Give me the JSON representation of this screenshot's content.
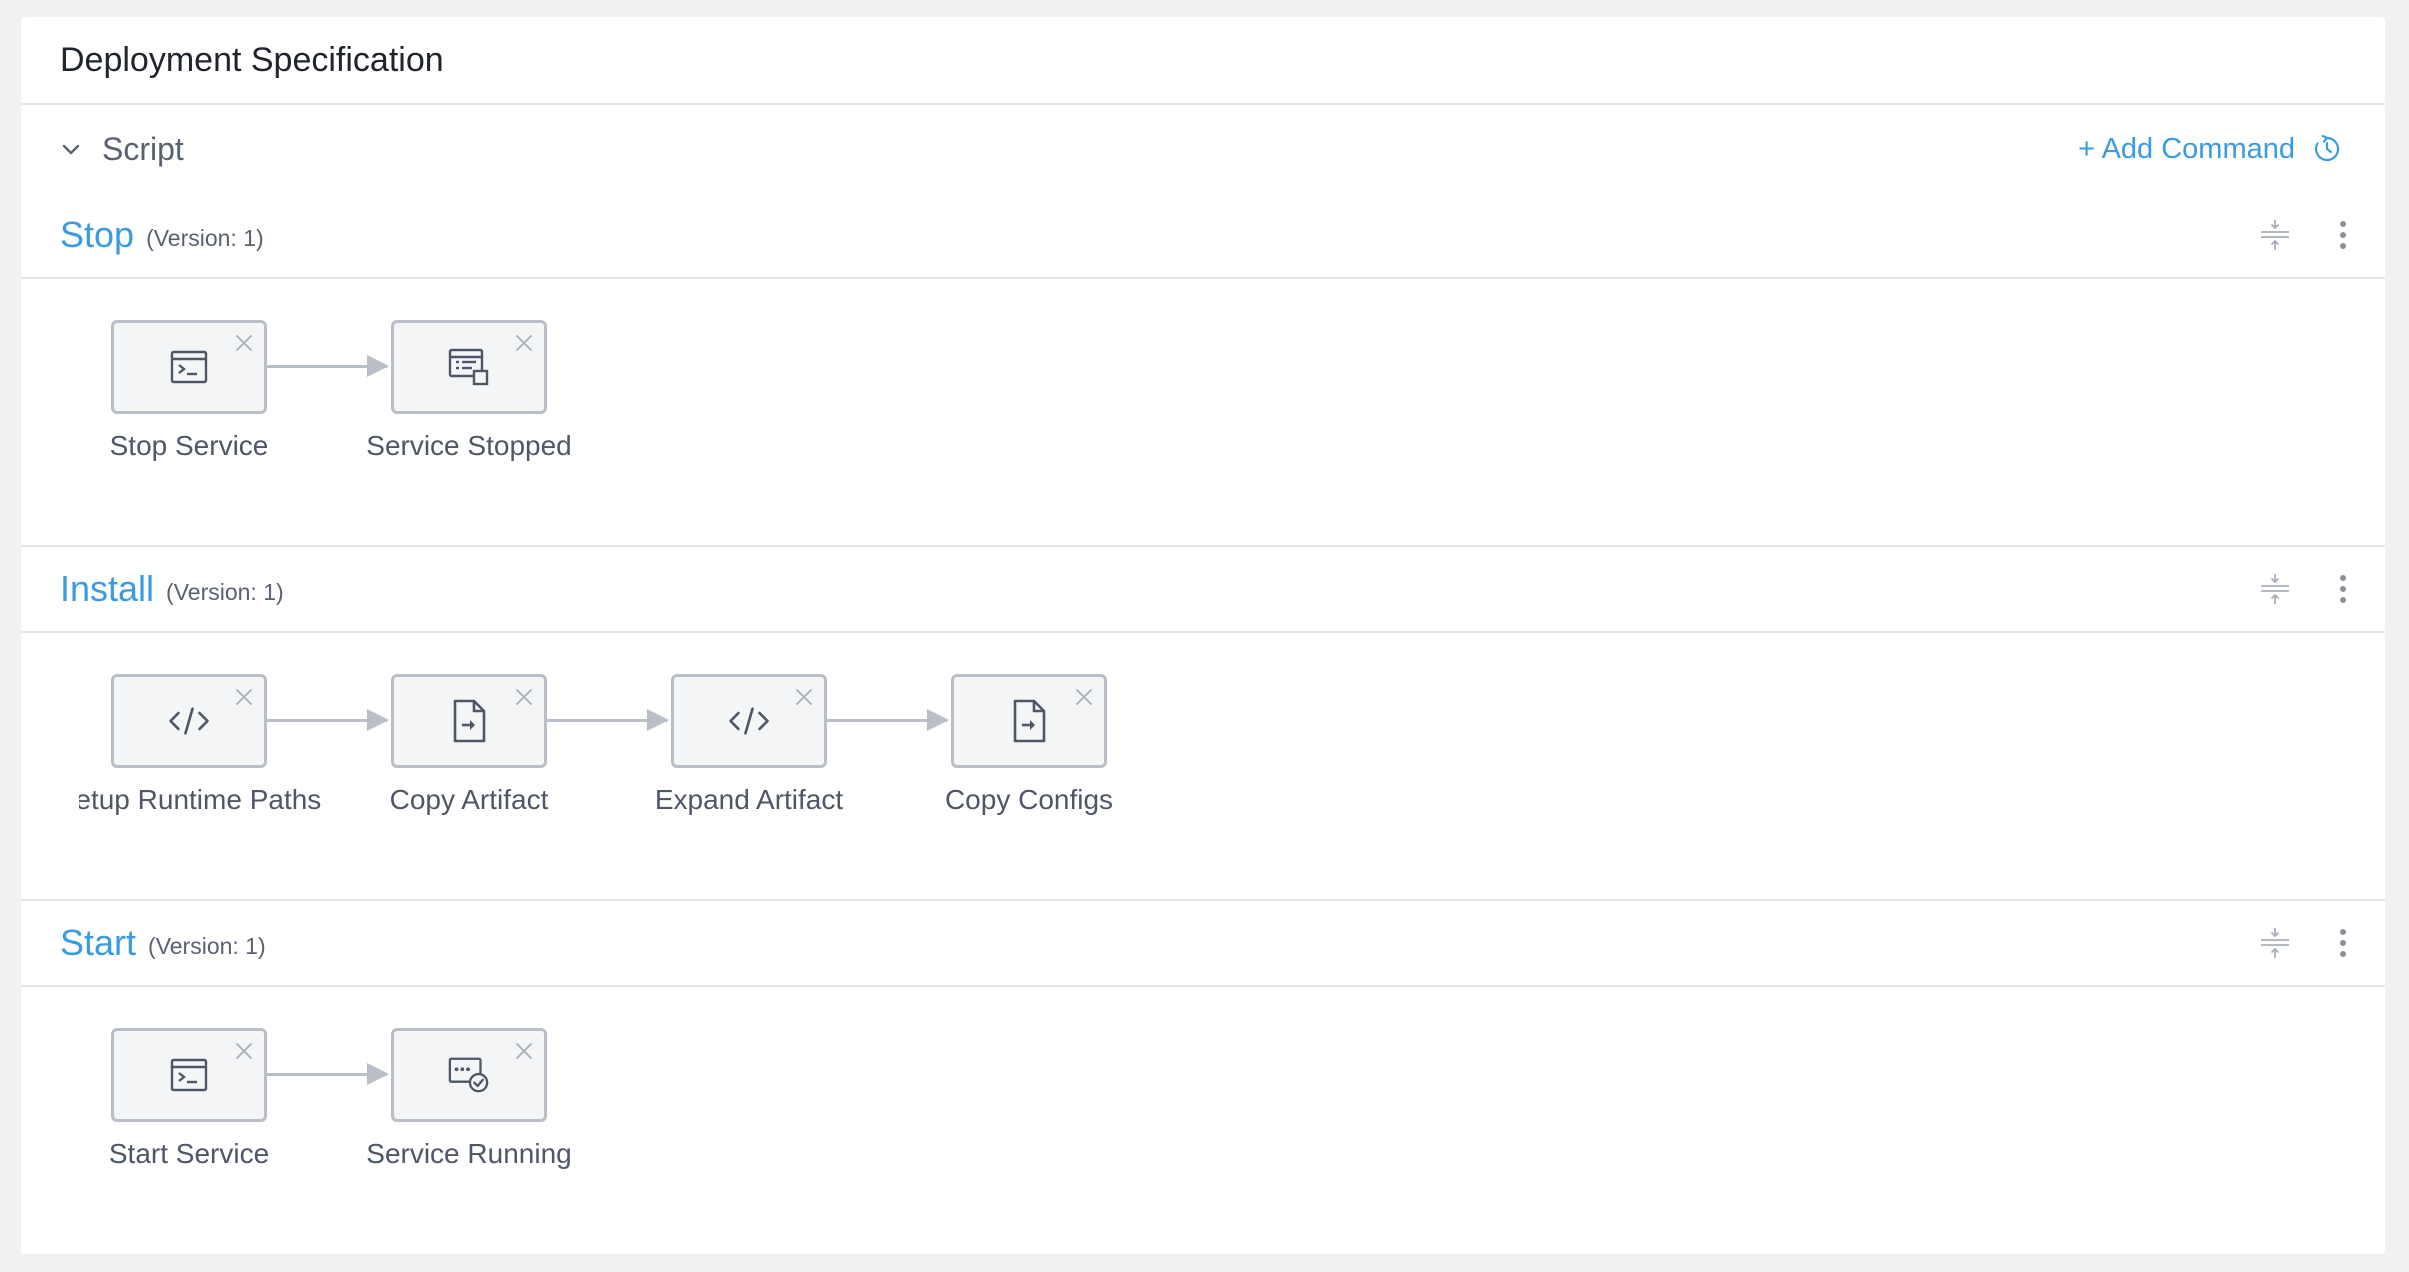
{
  "header": {
    "title": "Deployment Specification"
  },
  "script": {
    "label": "Script",
    "add_command": "+ Add Command"
  },
  "sections": [
    {
      "title": "Stop",
      "version": "(Version: 1)",
      "steps": [
        {
          "label": "Stop Service",
          "icon": "terminal-icon"
        },
        {
          "label": "Service Stopped",
          "icon": "service-list-icon"
        }
      ]
    },
    {
      "title": "Install",
      "version": "(Version: 1)",
      "steps": [
        {
          "label": "Setup Runtime Paths",
          "icon": "code-icon"
        },
        {
          "label": "Copy Artifact",
          "icon": "file-copy-icon"
        },
        {
          "label": "Expand Artifact",
          "icon": "code-icon"
        },
        {
          "label": "Copy Configs",
          "icon": "file-copy-icon"
        }
      ]
    },
    {
      "title": "Start",
      "version": "(Version: 1)",
      "steps": [
        {
          "label": "Start Service",
          "icon": "terminal-icon"
        },
        {
          "label": "Service Running",
          "icon": "service-check-icon"
        }
      ]
    }
  ],
  "colors": {
    "accent": "#3a9be0",
    "border": "#b9bec7",
    "background": "#f0f1f3"
  }
}
